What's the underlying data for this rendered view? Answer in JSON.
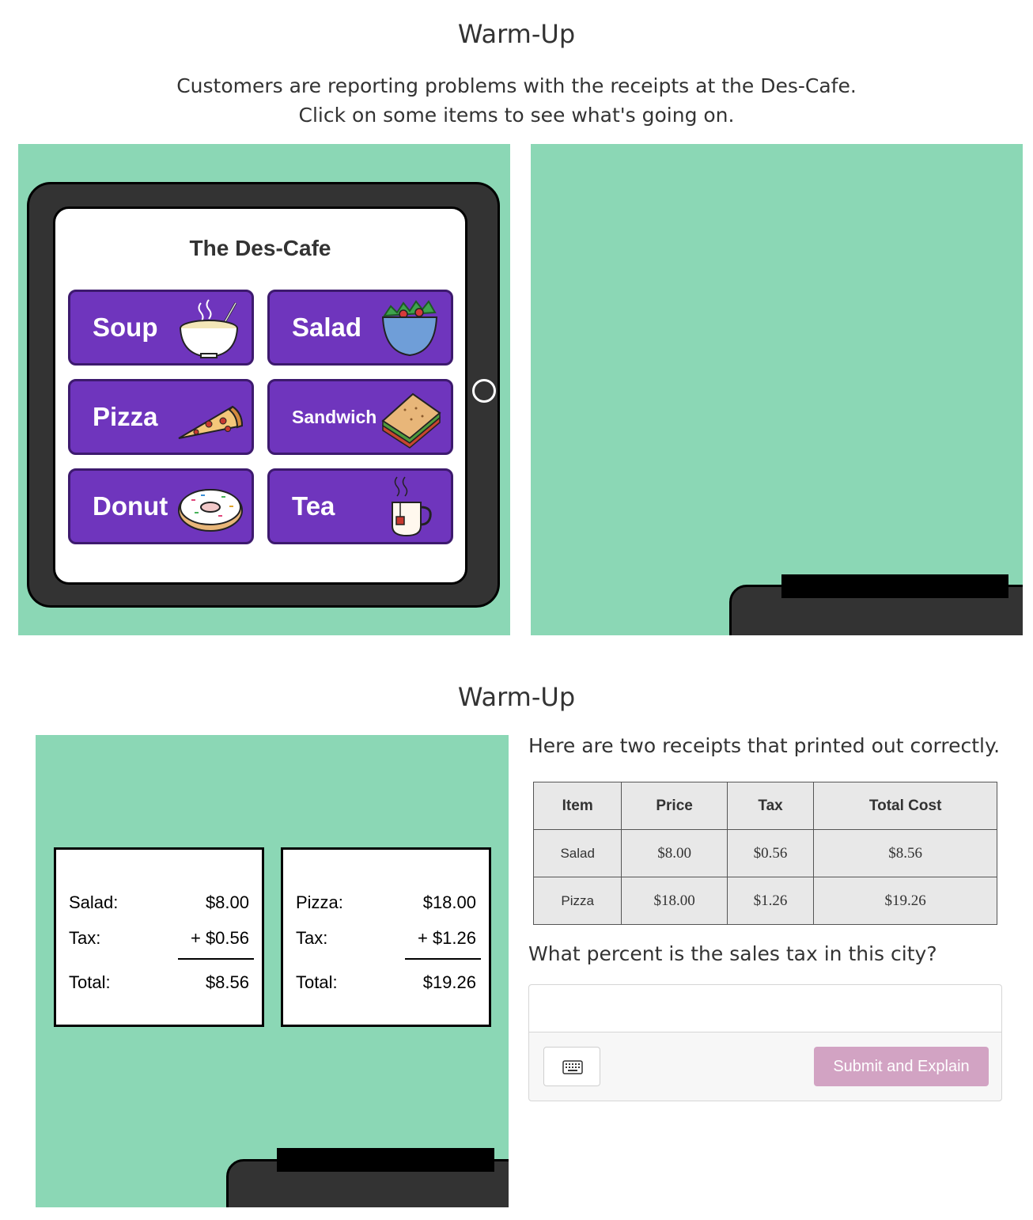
{
  "screen1": {
    "title": "Warm-Up",
    "intro_line1": "Customers are reporting problems with the receipts at the Des-Cafe.",
    "intro_line2": "Click on some items to see what's going on.",
    "cafe_title": "The Des-Cafe",
    "menu": [
      {
        "label": "Soup",
        "icon": "soup-bowl-icon"
      },
      {
        "label": "Salad",
        "icon": "salad-bowl-icon"
      },
      {
        "label": "Pizza",
        "icon": "pizza-slice-icon"
      },
      {
        "label": "Sandwich",
        "icon": "sandwich-icon"
      },
      {
        "label": "Donut",
        "icon": "donut-icon"
      },
      {
        "label": "Tea",
        "icon": "tea-cup-icon"
      }
    ]
  },
  "screen2": {
    "title": "Warm-Up",
    "receipts": [
      {
        "item": "Salad:",
        "price": "$8.00",
        "tax_label": "Tax:",
        "tax": "+ $0.56",
        "total_label": "Total:",
        "total": "$8.56"
      },
      {
        "item": "Pizza:",
        "price": "$18.00",
        "tax_label": "Tax:",
        "tax": "+ $1.26",
        "total_label": "Total:",
        "total": "$19.26"
      }
    ],
    "prompt": "Here are two receipts that printed out correctly.",
    "table": {
      "headers": [
        "Item",
        "Price",
        "Tax",
        "Total Cost"
      ],
      "rows": [
        [
          "Salad",
          "$8.00",
          "$0.56",
          "$8.56"
        ],
        [
          "Pizza",
          "$18.00",
          "$1.26",
          "$19.26"
        ]
      ]
    },
    "question": "What percent is the sales tax in this city?",
    "answer_value": "",
    "submit_label": "Submit and Explain"
  },
  "colors": {
    "panel_green": "#8bd7b5",
    "menu_purple": "#6f35bd",
    "device_dark": "#333333",
    "submit_pink": "#d2a3c3"
  }
}
